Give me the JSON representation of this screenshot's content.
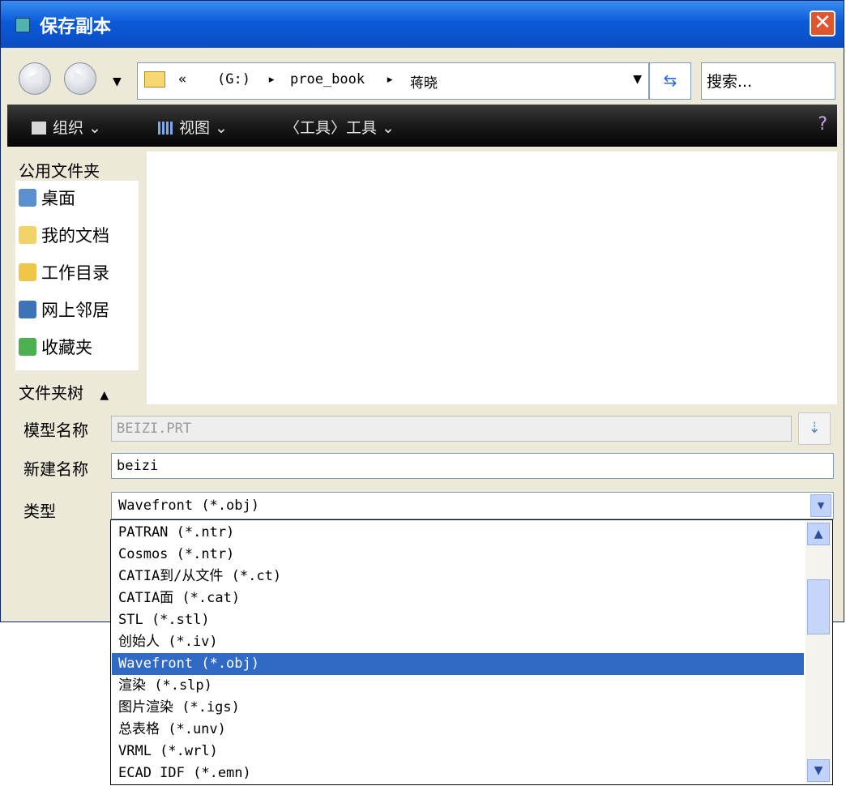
{
  "window": {
    "title": "保存副本",
    "close_label": "✕"
  },
  "address": {
    "prefix": "«",
    "segments": [
      "(G:)",
      "▸",
      "proe_book",
      "▸",
      "蒋晓"
    ],
    "search_placeholder": "搜索..."
  },
  "toolbar": {
    "organize": "组织 ⌄",
    "view": "视图 ⌄",
    "tools": "〈工具〉工具 ⌄"
  },
  "sidebar": {
    "header": "公用文件夹",
    "items": [
      {
        "label": "桌面",
        "icon": "desktop-icon"
      },
      {
        "label": "我的文档",
        "icon": "documents-icon"
      },
      {
        "label": "工作目录",
        "icon": "working-dir-icon"
      },
      {
        "label": "网上邻居",
        "icon": "network-icon"
      },
      {
        "label": "收藏夹",
        "icon": "favorites-icon"
      }
    ],
    "tree_label": "文件夹树",
    "tree_toggle": "▲"
  },
  "form": {
    "model_name_label": "模型名称",
    "model_name_value": "BEIZI.PRT",
    "new_name_label": "新建名称",
    "new_name_value": "beizi",
    "type_label": "类型",
    "type_value": "Wavefront (*.obj)"
  },
  "dropdown": {
    "options": [
      "PATRAN (*.ntr)",
      "Cosmos (*.ntr)",
      "CATIA到/从文件 (*.ct)",
      "CATIA面 (*.cat)",
      "STL (*.stl)",
      "创始人 (*.iv)",
      "Wavefront (*.obj)",
      "渲染 (*.slp)",
      "图片渲染 (*.igs)",
      "总表格 (*.unv)",
      "VRML (*.wrl)",
      "ECAD IDF (*.emn)"
    ],
    "selected_index": 6
  },
  "colors": {
    "titlebar": "#0B5BD8",
    "selection": "#316AC5",
    "dialog_bg": "#ECE9D8"
  }
}
